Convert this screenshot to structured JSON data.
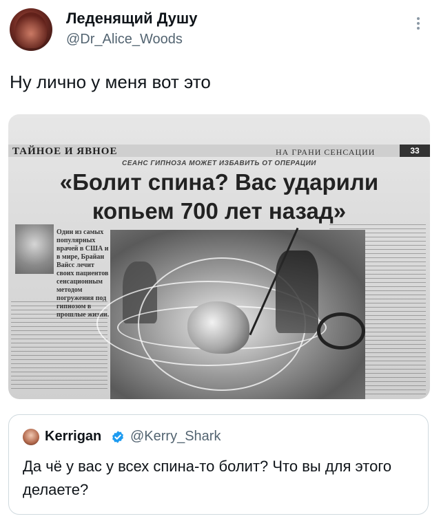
{
  "tweet": {
    "author_name": "Леденящий Душу",
    "author_handle": "@Dr_Alice_Woods",
    "text": "Ну лично у меня вот это"
  },
  "newspaper": {
    "section_left": "ТАЙНОЕ И ЯВНОЕ",
    "section_right": "НА ГРАНИ СЕНСАЦИИ",
    "page_number": "33",
    "kicker": "СЕАНС ГИПНОЗА МОЖЕТ ИЗБАВИТЬ ОТ ОПЕРАЦИИ",
    "headline_line1": "«Болит спина? Вас ударили",
    "headline_line2": "копьем 700 лет назад»",
    "intro_text": "Один из самых популярных врачей в США и в мире, Брайан Вайсс лечит своих пациентов сенсационным методом погружения под гипнозом в прошлые жизни."
  },
  "quoted_tweet": {
    "author_name": "Kerrigan",
    "author_handle": "@Kerry_Shark",
    "text": "Да чё у вас у всех спина-то болит? Что вы для этого делаете?"
  },
  "icons": {
    "more": "more-icon",
    "verified": "verified-badge-icon"
  },
  "colors": {
    "verified_blue": "#1d9bf0",
    "secondary_text": "#536471"
  }
}
